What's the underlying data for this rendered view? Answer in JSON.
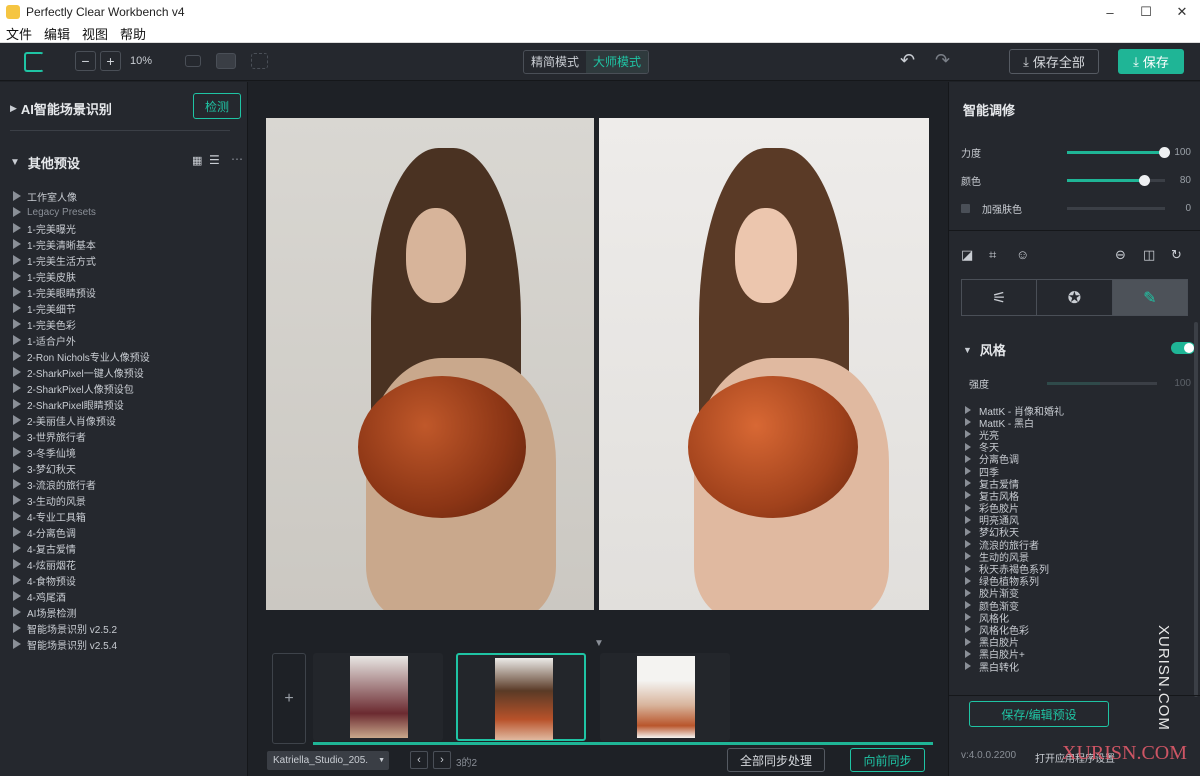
{
  "window": {
    "title": "Perfectly Clear Workbench v4",
    "controls": [
      "–",
      "☐",
      "✕"
    ]
  },
  "menu": [
    "文件",
    "编辑",
    "视图",
    "帮助"
  ],
  "toolbar": {
    "zoom_minus": "−",
    "zoom_plus": "+",
    "zoom": "10%",
    "mode_simple": "精简模式",
    "mode_master": "大师模式",
    "save_all": "保存全部",
    "save": "保存",
    "undo": "↶",
    "redo": "↷"
  },
  "left": {
    "ai_section": "AI智能场景识别",
    "detect_button": "检测",
    "presets_section": "其他预设",
    "presets": [
      "工作室人像",
      "Legacy Presets",
      "1-完美曝光",
      "1-完美清晰基本",
      "1-完美生活方式",
      "1-完美皮肤",
      "1-完美眼睛预设",
      "1-完美细节",
      "1-完美色彩",
      "1-适合户外",
      "2-Ron Nichols专业人像预设",
      "2-SharkPixel一键人像预设",
      "2-SharkPixel人像预设包",
      "2-SharkPixel眼睛预设",
      "2-美丽佳人肖像预设",
      "3-世界旅行者",
      "3-冬季仙境",
      "3-梦幻秋天",
      "3-流浪的旅行者",
      "3-生动的风景",
      "4-专业工具箱",
      "4-分离色调",
      "4-复古爱情",
      "4-炫丽烟花",
      "4-食物预设",
      "4-鸡尾酒",
      "AI场景检测",
      "智能场景识别 v2.5.2",
      "智能场景识别 v2.5.4"
    ]
  },
  "filmstrip": {
    "add": "+",
    "file_name": "Katriella_Studio_205.",
    "count": "3的2",
    "sync_all": "全部同步处理",
    "sync_prev": "向前同步",
    "prev": "‹",
    "next": "›"
  },
  "right": {
    "title": "智能调修",
    "sliders": [
      {
        "label": "力度",
        "value": "100",
        "level": 1.0
      },
      {
        "label": "颜色",
        "value": "80",
        "level": 0.8
      },
      {
        "label": "加强肤色",
        "value": "0",
        "level": 0.0
      }
    ],
    "style_section": "风格",
    "strength_label": "强度",
    "strength_value": "100",
    "styles": [
      "MattK - 肖像和婚礼",
      "MattK - 黑白",
      "光亮",
      "冬天",
      "分离色调",
      "四季",
      "复古爱情",
      "复古风格",
      "彩色胶片",
      "明亮通风",
      "梦幻秋天",
      "流浪的旅行者",
      "生动的风景",
      "秋天赤褐色系列",
      "绿色植物系列",
      "胶片渐变",
      "颜色渐变",
      "风格化",
      "风格化色彩",
      "黑白胶片",
      "黑白胶片+",
      "黑白转化"
    ],
    "preset_edit": "保存/编辑预设",
    "version": "v:4.0.0.2200",
    "open_text": "打开应用程序设置"
  },
  "watermark": {
    "vertical": "XURISN.COM",
    "horizontal": "XURISN.COM"
  }
}
